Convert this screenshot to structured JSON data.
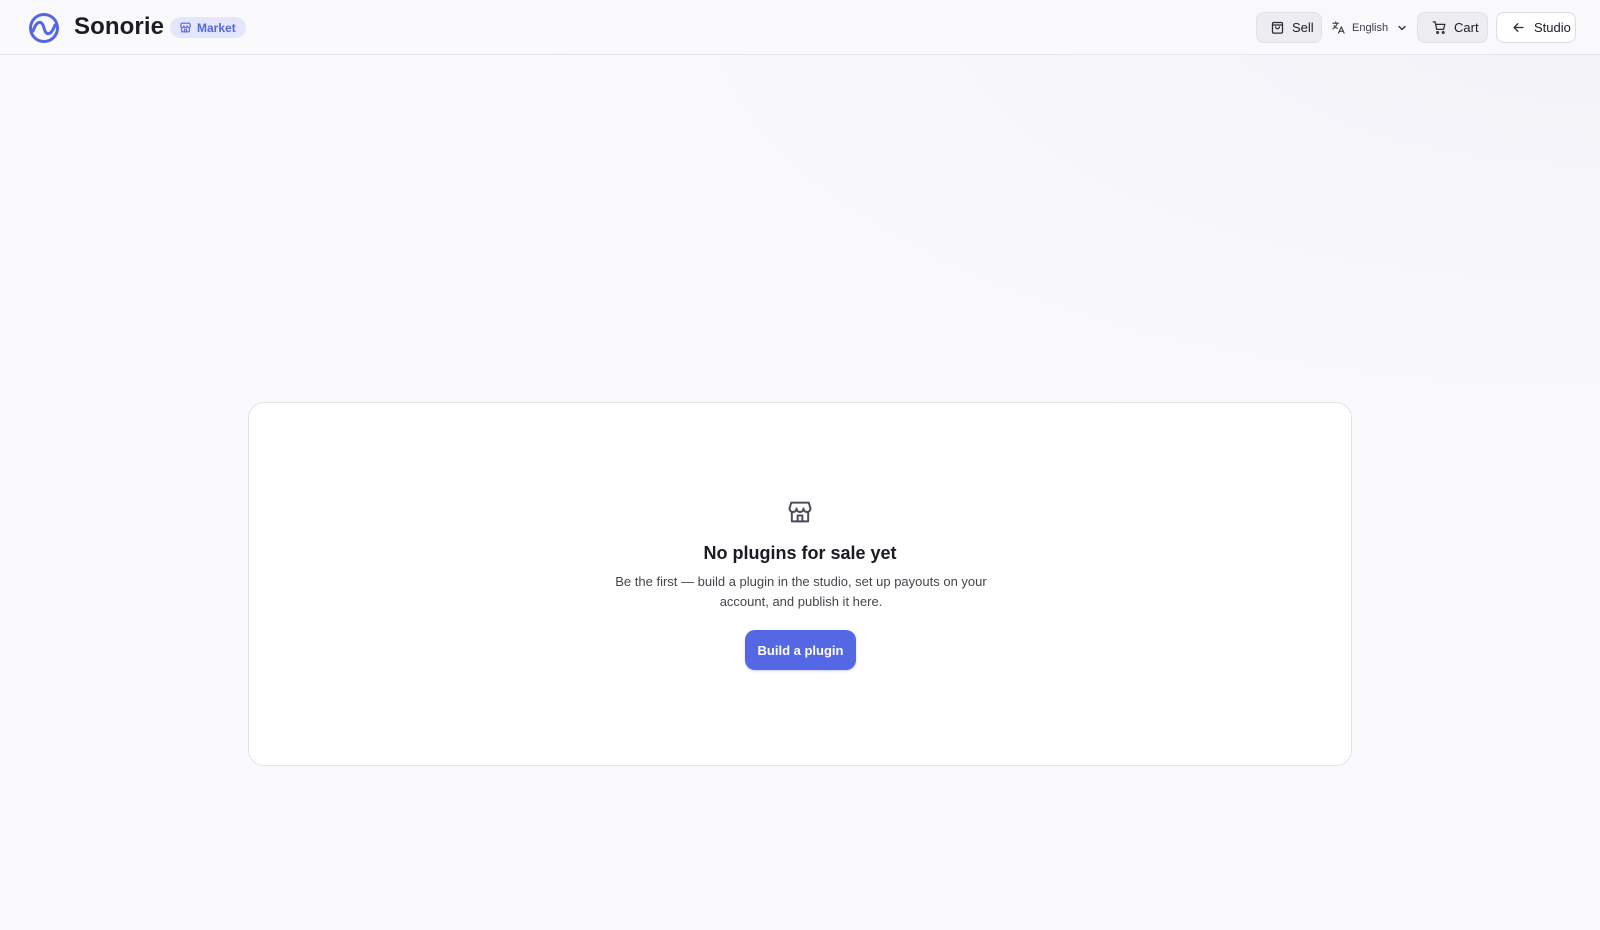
{
  "header": {
    "brand": "Sonorie",
    "badge": "Market",
    "sell_label": "Sell",
    "language": "English",
    "cart_label": "Cart",
    "studio_label": "Studio"
  },
  "empty_state": {
    "title": "No plugins for sale yet",
    "description": "Be the first — build a plugin in the studio, set up payouts on your account, and publish it here.",
    "cta_label": "Build a plugin"
  },
  "icons": {
    "logo": "sonorie-logo-icon",
    "badge": "store-icon",
    "sell": "shopping-bag-icon",
    "language": "translate-icon",
    "language_chevron": "chevron-down-icon",
    "cart": "cart-icon",
    "studio": "arrow-left-icon",
    "empty": "store-icon"
  },
  "colors": {
    "accent": "#5468e6",
    "badge_bg": "#e4e7fb",
    "badge_text": "#5567dd",
    "background": "#f8f8fb"
  }
}
